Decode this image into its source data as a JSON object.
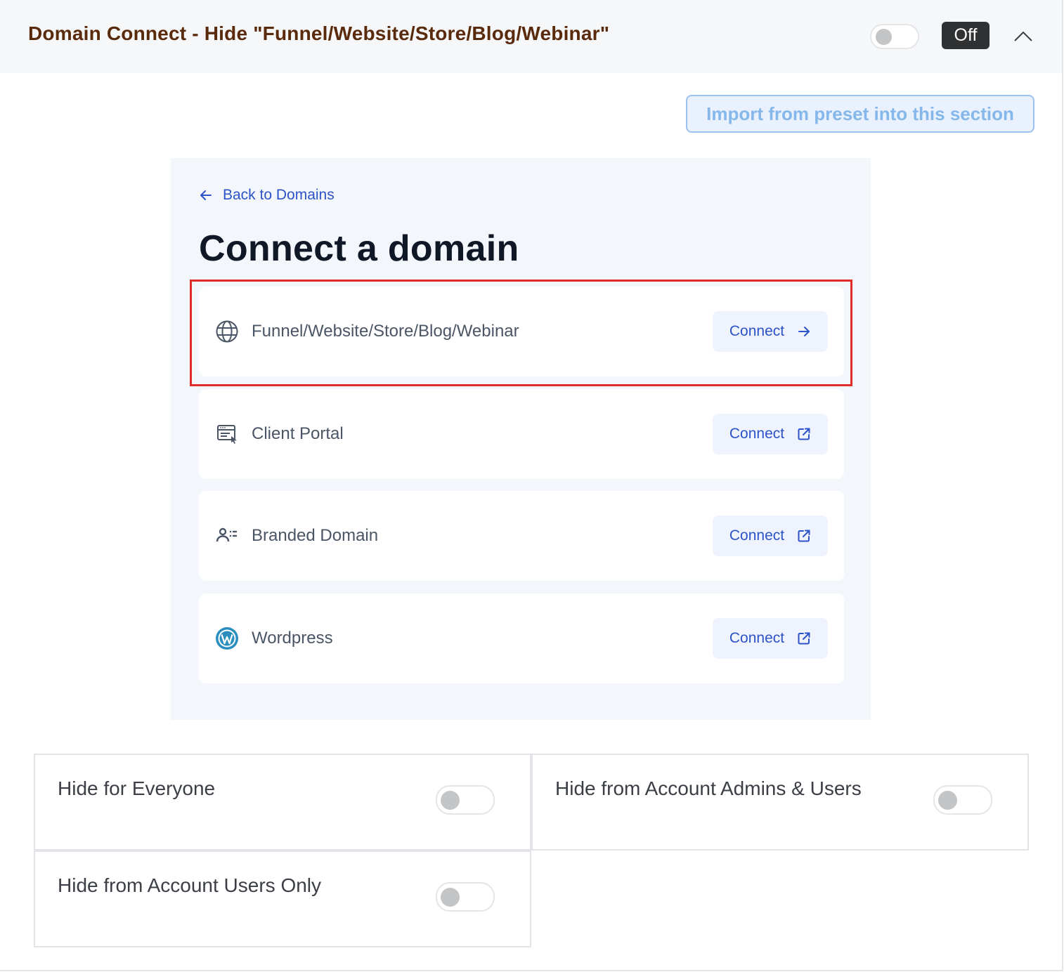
{
  "header": {
    "title": "Domain Connect - Hide \"Funnel/Website/Store/Blog/Webinar\"",
    "toggle_state": "off",
    "status_badge": "Off",
    "collapse_icon": "chevron-up-icon"
  },
  "import_button": {
    "label": "Import from preset into this section"
  },
  "screenshot": {
    "back_link": {
      "icon": "arrow-left-icon",
      "label": "Back to Domains"
    },
    "title": "Connect a domain",
    "cards": [
      {
        "icon": "globe-icon",
        "label": "Funnel/Website/Store/Blog/Webinar",
        "button": "Connect",
        "button_icon": "arrow-right-icon",
        "highlighted": true
      },
      {
        "icon": "client-portal-icon",
        "label": "Client Portal",
        "button": "Connect",
        "button_icon": "external-link-icon"
      },
      {
        "icon": "branded-domain-icon",
        "label": "Branded Domain",
        "button": "Connect",
        "button_icon": "external-link-icon"
      },
      {
        "icon": "wordpress-icon",
        "label": "Wordpress",
        "button": "Connect",
        "button_icon": "external-link-icon"
      }
    ],
    "highlight_color": "#e02b2b",
    "accent_color": "#2c53c8"
  },
  "options": [
    {
      "label": "Hide for Everyone",
      "enabled": false
    },
    {
      "label": "Hide from Account Admins & Users",
      "enabled": false
    },
    {
      "label": "Hide from Account Users Only",
      "enabled": false
    }
  ]
}
